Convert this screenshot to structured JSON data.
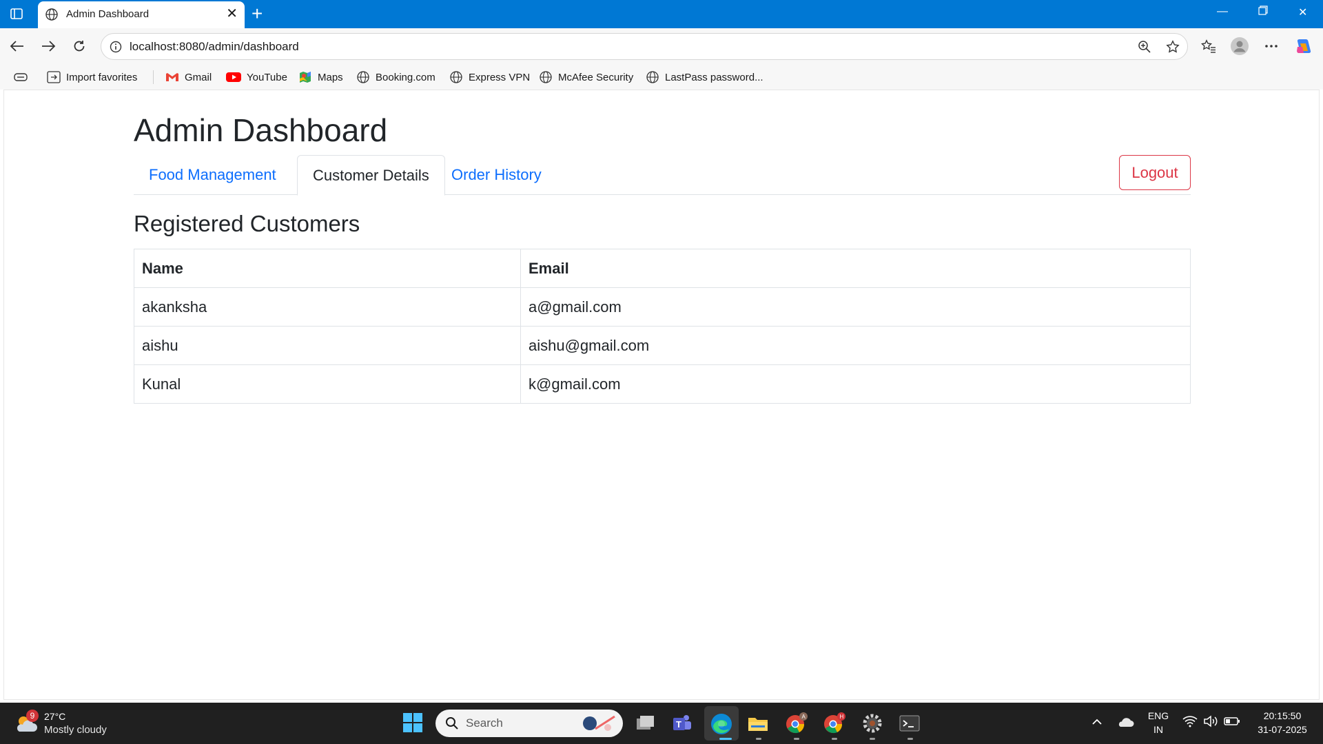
{
  "browser": {
    "tab_title": "Admin Dashboard",
    "url": "localhost:8080/admin/dashboard",
    "favorites": [
      {
        "label": "Import favorites",
        "icon": "import-icon"
      },
      {
        "label": "Gmail",
        "icon": "gmail-icon"
      },
      {
        "label": "YouTube",
        "icon": "youtube-icon"
      },
      {
        "label": "Maps",
        "icon": "maps-icon"
      },
      {
        "label": "Booking.com",
        "icon": "globe-icon"
      },
      {
        "label": "Express VPN",
        "icon": "globe-icon"
      },
      {
        "label": "McAfee Security",
        "icon": "globe-icon"
      },
      {
        "label": "LastPass password...",
        "icon": "globe-icon"
      }
    ]
  },
  "page": {
    "title": "Admin Dashboard",
    "tabs": [
      {
        "label": "Food Management",
        "active": false
      },
      {
        "label": "Customer Details",
        "active": true
      },
      {
        "label": "Order History",
        "active": false
      }
    ],
    "logout_label": "Logout",
    "section_title": "Registered Customers",
    "table": {
      "headers": [
        "Name",
        "Email"
      ],
      "rows": [
        [
          "akanksha",
          "a@gmail.com"
        ],
        [
          "aishu",
          "aishu@gmail.com"
        ],
        [
          "Kunal",
          "k@gmail.com"
        ]
      ]
    }
  },
  "taskbar": {
    "weather_temp": "27°C",
    "weather_desc": "Mostly cloudy",
    "weather_badge": "9",
    "search_placeholder": "Search",
    "language_line1": "ENG",
    "language_line2": "IN",
    "time": "20:15:50",
    "date": "31-07-2025"
  },
  "colors": {
    "titlebar": "#0078d4",
    "link": "#0d6efd",
    "danger": "#dc3545"
  }
}
